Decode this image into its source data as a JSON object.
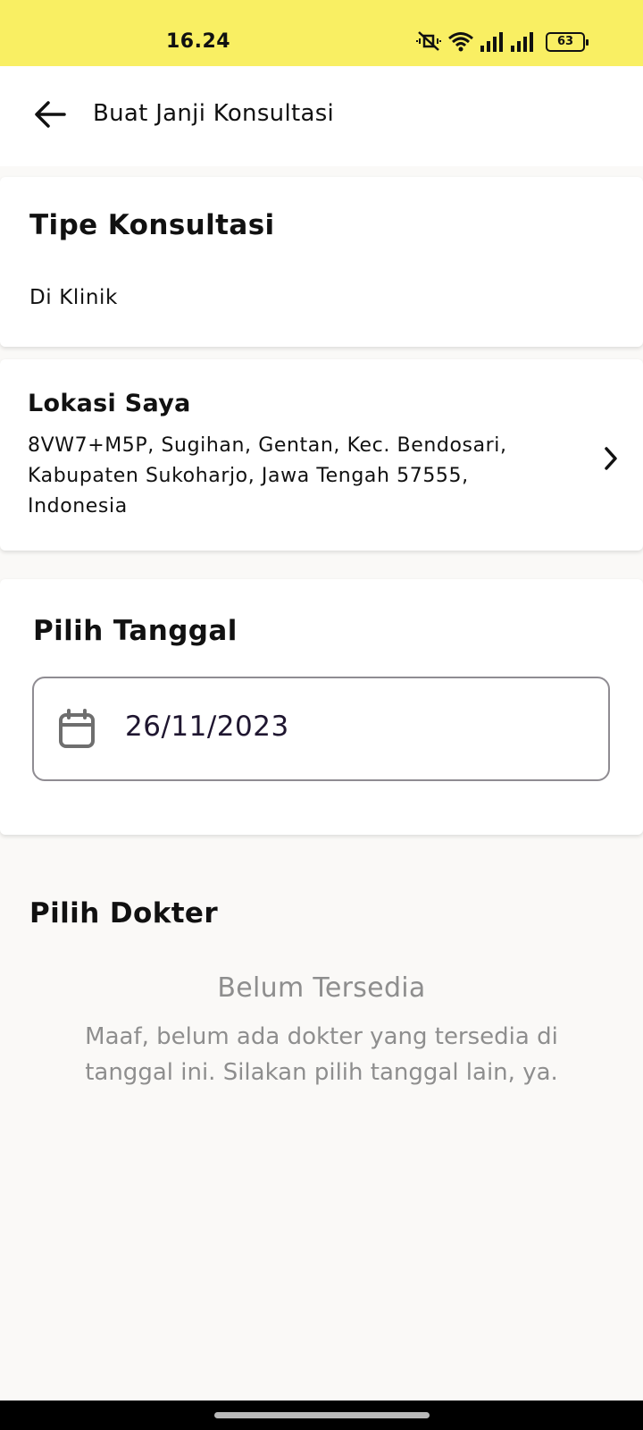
{
  "status_bar": {
    "time": "16.24",
    "battery": "63",
    "icons": [
      "mute-vibrate-icon",
      "wifi-icon",
      "signal-icon",
      "signal-icon",
      "battery-icon"
    ],
    "background": "#f9ef63"
  },
  "app_bar": {
    "title": "Buat Janji Konsultasi",
    "back_icon": "arrow-left-icon"
  },
  "consultation_type": {
    "heading": "Tipe Konsultasi",
    "value": "Di Klinik"
  },
  "location": {
    "heading": "Lokasi Saya",
    "address": "8VW7+M5P, Sugihan, Gentan, Kec. Bendosari, Kabupaten Sukoharjo, Jawa Tengah 57555, Indonesia",
    "chevron_icon": "chevron-right-icon"
  },
  "date": {
    "heading": "Pilih Tanggal",
    "value": "26/11/2023",
    "icon": "calendar-icon"
  },
  "doctor": {
    "heading": "Pilih Dokter",
    "empty_title": "Belum Tersedia",
    "empty_message": "Maaf, belum ada dokter yang tersedia di tanggal ini. Silakan pilih tanggal lain, ya."
  }
}
